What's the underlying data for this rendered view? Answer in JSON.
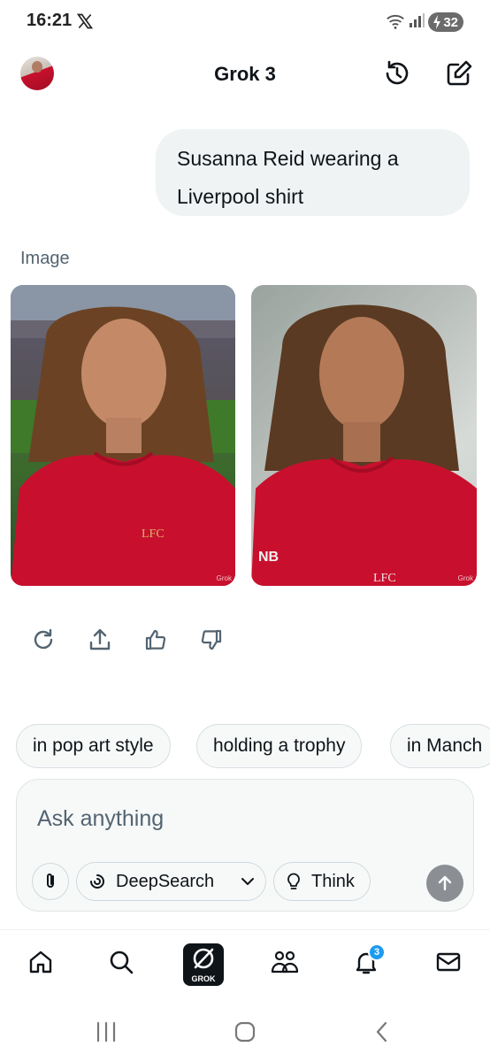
{
  "status_bar": {
    "time": "16:21",
    "battery": "32"
  },
  "header": {
    "title": "Grok 3"
  },
  "message": {
    "user_text": "Susanna Reid wearing a Liverpool shirt"
  },
  "image_section": {
    "label": "Image",
    "watermark": "Grok"
  },
  "suggestions": [
    "in pop art style",
    "holding a trophy",
    "in Manch"
  ],
  "composer": {
    "placeholder": "Ask anything",
    "deepsearch_label": "DeepSearch",
    "think_label": "Think"
  },
  "bottom_nav": {
    "grok_label": "GROK",
    "notification_count": "3"
  },
  "colors": {
    "accent": "#1d9bf0",
    "liverpool_red": "#c8102e",
    "text": "#0f1419",
    "muted": "#536471"
  }
}
